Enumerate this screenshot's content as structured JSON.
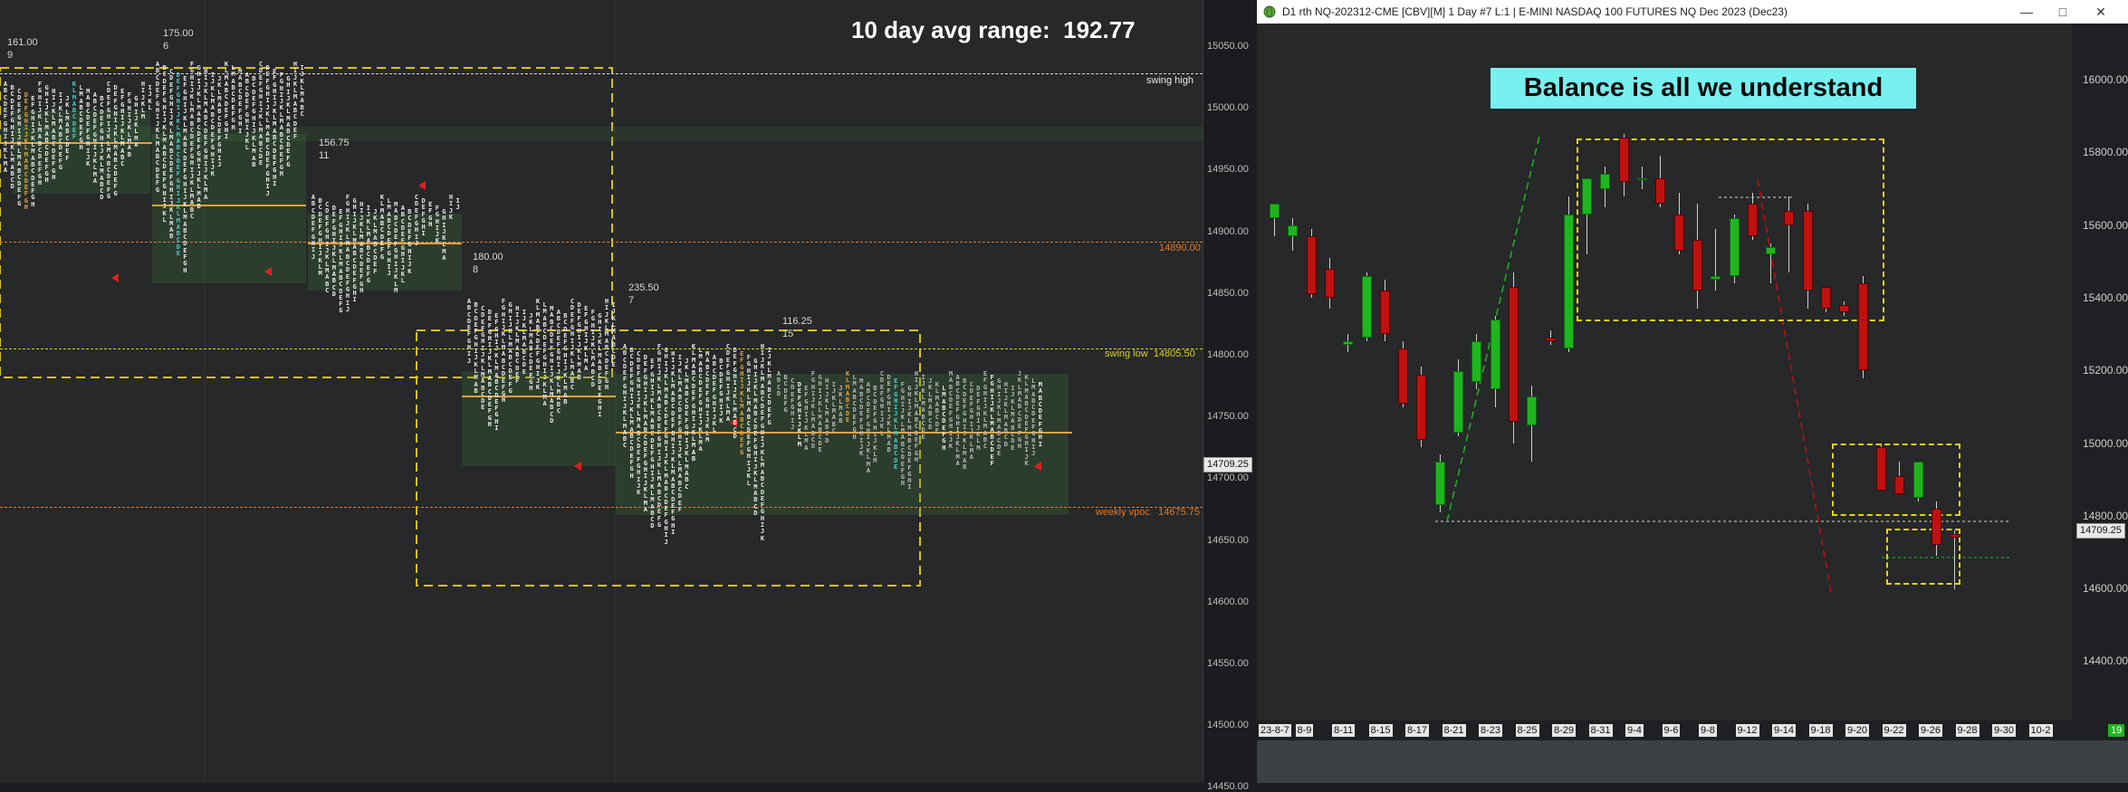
{
  "left_chart": {
    "avg_range_label": "10 day avg range:",
    "avg_range_value": "192.77",
    "price_axis": [
      "15050.00",
      "15000.00",
      "14950.00",
      "14900.00",
      "14850.00",
      "14800.00",
      "14750.00",
      "14700.00",
      "14650.00",
      "14600.00",
      "14550.00",
      "14500.00",
      "14450.00"
    ],
    "current_price_tag": "14709.25",
    "levels": [
      {
        "name": "swing high",
        "price": "",
        "color": "#dddddd"
      },
      {
        "name": "",
        "price": "14890.00",
        "color": "#e07a2a"
      },
      {
        "name": "swing low",
        "price": "14805.50",
        "color": "#d8d020"
      },
      {
        "name": "weekly vpoc",
        "price": "14675.75",
        "color": "#e07a2a"
      }
    ],
    "sessions": [
      {
        "range": "161.00",
        "count": "9"
      },
      {
        "range": "175.00",
        "count": "6"
      },
      {
        "range": "156.75",
        "count": "11"
      },
      {
        "range": "180.00",
        "count": "8"
      },
      {
        "range": "235.50",
        "count": "7"
      },
      {
        "range": "116.25",
        "count": "15"
      }
    ]
  },
  "right_window": {
    "title": "D1 rth NQ-202312-CME [CBV][M]  1 Day  #7 L:1 | E-MINI NASDAQ 100 FUTURES NQ Dec 2023 (Dec23)",
    "annotation": "Balance is all we understand",
    "price_axis": [
      "16000.00",
      "15800.00",
      "15600.00",
      "15400.00",
      "15200.00",
      "15000.00",
      "14800.00",
      "14600.00",
      "14400.00"
    ],
    "current_price_tag": "14709.25",
    "date_axis": [
      "23-8-7",
      "8-9",
      "8-11",
      "8-15",
      "8-17",
      "8-21",
      "8-23",
      "8-25",
      "8-29",
      "8-31",
      "9-4",
      "9-6",
      "9-8",
      "9-12",
      "9-14",
      "9-18",
      "9-20",
      "9-22",
      "9-26",
      "9-28",
      "9-30",
      "10-2"
    ],
    "corner_tag": "19",
    "colors": {
      "up": "#1fb51f",
      "down": "#c01010",
      "box": "#e6d21a",
      "annotation_bg": "#77f0f0"
    },
    "candles": [
      {
        "o": 15620,
        "h": 15650,
        "l": 15570,
        "c": 15660
      },
      {
        "o": 15570,
        "h": 15620,
        "l": 15530,
        "c": 15600
      },
      {
        "o": 15570,
        "h": 15590,
        "l": 15400,
        "c": 15410
      },
      {
        "o": 15480,
        "h": 15510,
        "l": 15370,
        "c": 15400
      },
      {
        "o": 15270,
        "h": 15300,
        "l": 15250,
        "c": 15280
      },
      {
        "o": 15290,
        "h": 15470,
        "l": 15280,
        "c": 15460
      },
      {
        "o": 15420,
        "h": 15450,
        "l": 15280,
        "c": 15300
      },
      {
        "o": 15260,
        "h": 15280,
        "l": 15100,
        "c": 15110
      },
      {
        "o": 15190,
        "h": 15210,
        "l": 14990,
        "c": 15010
      },
      {
        "o": 14830,
        "h": 14970,
        "l": 14810,
        "c": 14950
      },
      {
        "o": 15030,
        "h": 15230,
        "l": 15020,
        "c": 15200
      },
      {
        "o": 15170,
        "h": 15300,
        "l": 15150,
        "c": 15280
      },
      {
        "o": 15150,
        "h": 15350,
        "l": 15100,
        "c": 15340
      },
      {
        "o": 15430,
        "h": 15470,
        "l": 15000,
        "c": 15060
      },
      {
        "o": 15050,
        "h": 15160,
        "l": 14950,
        "c": 15130
      },
      {
        "o": 15290,
        "h": 15310,
        "l": 15270,
        "c": 15280
      },
      {
        "o": 15260,
        "h": 15680,
        "l": 15250,
        "c": 15630
      },
      {
        "o": 15630,
        "h": 15730,
        "l": 15520,
        "c": 15730
      },
      {
        "o": 15700,
        "h": 15760,
        "l": 15650,
        "c": 15740
      },
      {
        "o": 15840,
        "h": 15850,
        "l": 15680,
        "c": 15720
      },
      {
        "o": 15730,
        "h": 15760,
        "l": 15700,
        "c": 15730
      },
      {
        "o": 15730,
        "h": 15790,
        "l": 15650,
        "c": 15660
      },
      {
        "o": 15630,
        "h": 15690,
        "l": 15520,
        "c": 15530
      },
      {
        "o": 15560,
        "h": 15660,
        "l": 15370,
        "c": 15420
      },
      {
        "o": 15450,
        "h": 15590,
        "l": 15420,
        "c": 15460
      },
      {
        "o": 15460,
        "h": 15630,
        "l": 15440,
        "c": 15620
      },
      {
        "o": 15660,
        "h": 15690,
        "l": 15560,
        "c": 15570
      },
      {
        "o": 15520,
        "h": 15550,
        "l": 15440,
        "c": 15540
      },
      {
        "o": 15640,
        "h": 15680,
        "l": 15470,
        "c": 15600
      },
      {
        "o": 15640,
        "h": 15660,
        "l": 15370,
        "c": 15420
      },
      {
        "o": 15430,
        "h": 15420,
        "l": 15360,
        "c": 15370
      },
      {
        "o": 15380,
        "h": 15390,
        "l": 15350,
        "c": 15360
      },
      {
        "o": 15440,
        "h": 15460,
        "l": 15180,
        "c": 15200
      },
      {
        "o": 14990,
        "h": 15000,
        "l": 14870,
        "c": 14870
      },
      {
        "o": 14910,
        "h": 14950,
        "l": 14860,
        "c": 14860
      },
      {
        "o": 14850,
        "h": 14950,
        "l": 14840,
        "c": 14950
      },
      {
        "o": 14820,
        "h": 14840,
        "l": 14690,
        "c": 14720
      },
      {
        "o": 14750,
        "h": 14760,
        "l": 14600,
        "c": 14740
      }
    ]
  }
}
